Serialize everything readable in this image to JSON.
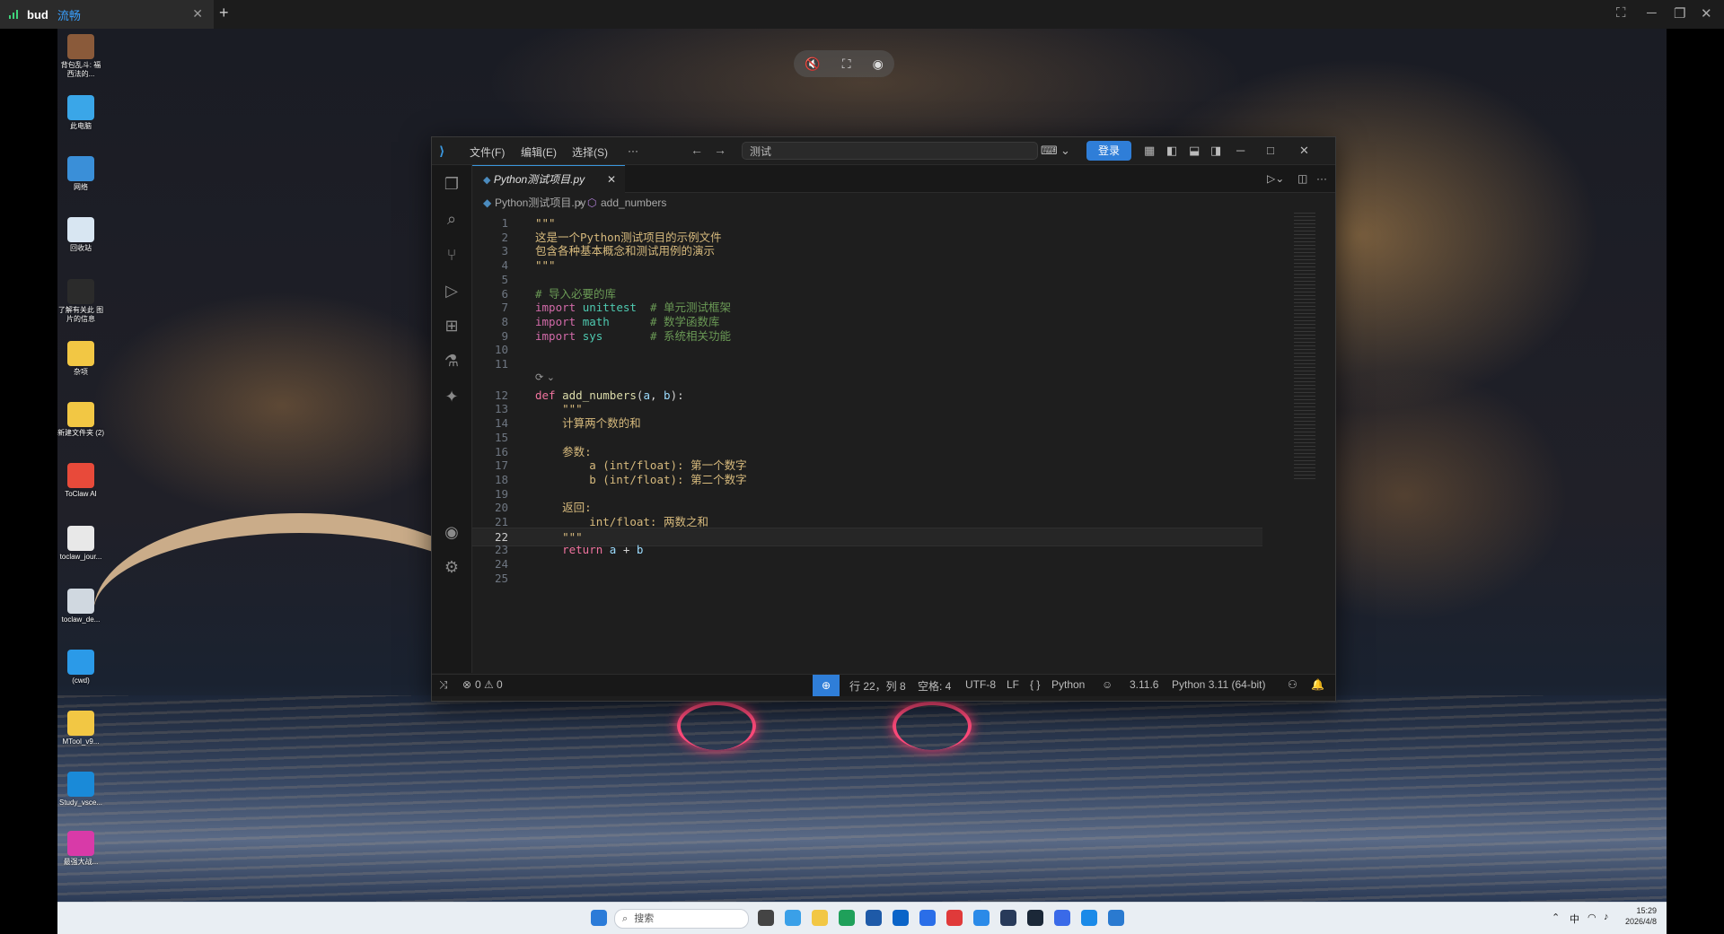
{
  "viewer": {
    "app_name": "bud",
    "status_text": "流畅",
    "close_glyph": "✕",
    "new_tab_glyph": "+"
  },
  "desktop_icons": [
    {
      "label": "背包乱斗: 福西法的...",
      "color": "#8a5a3a"
    },
    {
      "label": "此电脑",
      "color": "#3aa6e8"
    },
    {
      "label": "网络",
      "color": "#3a8fd8"
    },
    {
      "label": "回收站",
      "color": "#d8e6f2"
    },
    {
      "label": "了解有关此 图片的信息",
      "color": "#2b2b2b"
    },
    {
      "label": "杂项",
      "color": "#f2c744"
    },
    {
      "label": "新建文件夹 (2)",
      "color": "#f2c744"
    },
    {
      "label": "ToClaw AI",
      "color": "#e84a3a"
    },
    {
      "label": "toclaw_jour...",
      "color": "#e8e8e8"
    },
    {
      "label": "toclaw_de...",
      "color": "#d0d8e0"
    },
    {
      "label": "(cwd)",
      "color": "#2b9ae8"
    },
    {
      "label": "MTool_v9...",
      "color": "#f2c744"
    },
    {
      "label": "Study_vsce...",
      "color": "#1a8ad8"
    },
    {
      "label": "最强大战...",
      "color": "#d83aa8"
    }
  ],
  "vscode": {
    "menus": [
      "文件(F)",
      "编辑(E)",
      "选择(S)",
      "···"
    ],
    "command_center": "测试",
    "login_label": "登录",
    "tab": {
      "filename": "Python测试项目.py",
      "close_glyph": "✕"
    },
    "breadcrumb": {
      "file": "Python测试项目.py",
      "symbol": "add_numbers"
    },
    "codelens_glyph": "⟳ ⌄",
    "current_line": 22,
    "lines": [
      {
        "n": 1,
        "parts": [
          {
            "c": "doc",
            "t": "\"\"\""
          }
        ]
      },
      {
        "n": 2,
        "parts": [
          {
            "c": "doc",
            "t": "这是一个Python测试项目的示例文件"
          }
        ]
      },
      {
        "n": 3,
        "parts": [
          {
            "c": "doc",
            "t": "包含各种基本概念和测试用例的演示"
          }
        ]
      },
      {
        "n": 4,
        "parts": [
          {
            "c": "doc",
            "t": "\"\"\""
          }
        ]
      },
      {
        "n": 5,
        "parts": []
      },
      {
        "n": 6,
        "parts": [
          {
            "c": "cmt",
            "t": "# 导入必要的库"
          }
        ]
      },
      {
        "n": 7,
        "parts": [
          {
            "c": "kw",
            "t": "import "
          },
          {
            "c": "mod",
            "t": "unittest"
          },
          {
            "c": "plain",
            "t": "  "
          },
          {
            "c": "cmt",
            "t": "# 单元测试框架"
          }
        ]
      },
      {
        "n": 8,
        "parts": [
          {
            "c": "kw",
            "t": "import "
          },
          {
            "c": "mod",
            "t": "math"
          },
          {
            "c": "plain",
            "t": "      "
          },
          {
            "c": "cmt",
            "t": "# 数学函数库"
          }
        ]
      },
      {
        "n": 9,
        "parts": [
          {
            "c": "kw",
            "t": "import "
          },
          {
            "c": "mod",
            "t": "sys"
          },
          {
            "c": "plain",
            "t": "       "
          },
          {
            "c": "cmt",
            "t": "# 系统相关功能"
          }
        ]
      },
      {
        "n": 10,
        "parts": []
      },
      {
        "n": 11,
        "parts": []
      },
      {
        "n": 12,
        "lens": true,
        "parts": [
          {
            "c": "kw2",
            "t": "def "
          },
          {
            "c": "fn",
            "t": "add_numbers"
          },
          {
            "c": "plain",
            "t": "("
          },
          {
            "c": "prm",
            "t": "a"
          },
          {
            "c": "plain",
            "t": ", "
          },
          {
            "c": "prm",
            "t": "b"
          },
          {
            "c": "plain",
            "t": "):"
          }
        ]
      },
      {
        "n": 13,
        "parts": [
          {
            "c": "doc",
            "t": "    \"\"\""
          }
        ]
      },
      {
        "n": 14,
        "parts": [
          {
            "c": "doc",
            "t": "    计算两个数的和"
          }
        ]
      },
      {
        "n": 15,
        "parts": []
      },
      {
        "n": 16,
        "parts": [
          {
            "c": "doc",
            "t": "    参数:"
          }
        ]
      },
      {
        "n": 17,
        "parts": [
          {
            "c": "doc",
            "t": "        a (int/float): 第一个数字"
          }
        ]
      },
      {
        "n": 18,
        "parts": [
          {
            "c": "doc",
            "t": "        b (int/float): 第二个数字"
          }
        ]
      },
      {
        "n": 19,
        "parts": []
      },
      {
        "n": 20,
        "parts": [
          {
            "c": "doc",
            "t": "    返回:"
          }
        ]
      },
      {
        "n": 21,
        "parts": [
          {
            "c": "doc",
            "t": "        int/float: 两数之和"
          }
        ]
      },
      {
        "n": 22,
        "parts": [
          {
            "c": "doc",
            "t": "    \"\"\""
          }
        ]
      },
      {
        "n": 23,
        "parts": [
          {
            "c": "kw2",
            "t": "    return "
          },
          {
            "c": "prm",
            "t": "a"
          },
          {
            "c": "plain",
            "t": " + "
          },
          {
            "c": "prm",
            "t": "b"
          }
        ]
      },
      {
        "n": 24,
        "parts": []
      },
      {
        "n": 25,
        "parts": []
      }
    ],
    "status": {
      "errors": "0",
      "warnings": "0",
      "cursor": "行 22，列 8",
      "spaces": "空格: 4",
      "encoding": "UTF-8",
      "eol": "LF",
      "language": "Python",
      "version_short": "3.11.6",
      "interpreter": "Python 3.11 (64-bit)"
    }
  },
  "taskbar": {
    "search_placeholder": "搜索",
    "ime": "中",
    "time": "15:29",
    "date": "2026/4/8"
  }
}
